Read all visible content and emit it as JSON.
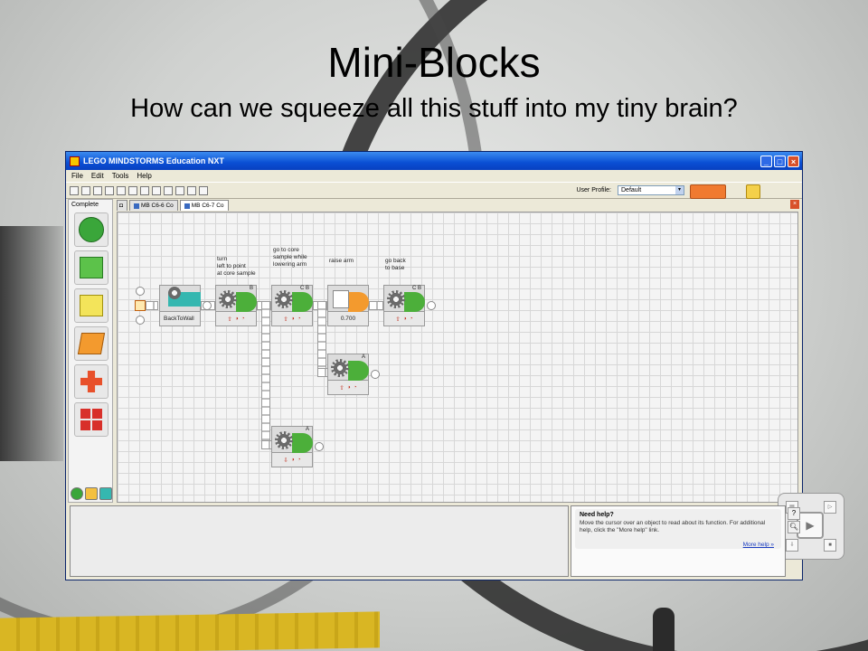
{
  "slide": {
    "title": "Mini-Blocks",
    "subtitle": "How can we squeeze all this stuff into my tiny brain?"
  },
  "window": {
    "title": "LEGO MINDSTORMS Education NXT",
    "menu": [
      "File",
      "Edit",
      "Tools",
      "Help"
    ],
    "user_profile_label": "User Profile:",
    "user_profile_value": "Default",
    "palette_title": "Complete",
    "tabs": [
      "MB C6-6 Co",
      "MB C6-7 Co"
    ],
    "active_tab": 1
  },
  "program": {
    "comments": {
      "turn": "turn\nleft to point\nat core sample",
      "go_core": "go to core\nsample while\nlowering arm",
      "raise": "raise arm",
      "back": "go back\nto base"
    },
    "blocks": [
      {
        "name": "BackToWall",
        "kind": "myblock"
      },
      {
        "ports": "B",
        "kind": "move"
      },
      {
        "ports": "C B",
        "kind": "move"
      },
      {
        "value": "0.700",
        "kind": "wait"
      },
      {
        "ports": "C B",
        "kind": "move"
      },
      {
        "ports": "A",
        "kind": "motor"
      },
      {
        "ports": "A",
        "kind": "motor"
      }
    ]
  },
  "help": {
    "title": "Need help?",
    "text": "Move the cursor over an object to read about its function. For additional help, click the \"More help\" link.",
    "link": "More help »"
  },
  "colors": {
    "block_green": "#4caf3a",
    "myblock_teal": "#35b7b0",
    "wait_orange": "#f39a2e",
    "titlebar_blue": "#0a4fd4"
  },
  "icons": {
    "palette": [
      "common-palette-icon",
      "complete-palette-icon",
      "custom-palette-icon"
    ],
    "side": [
      "help-question-icon",
      "zoom-icon"
    ]
  }
}
